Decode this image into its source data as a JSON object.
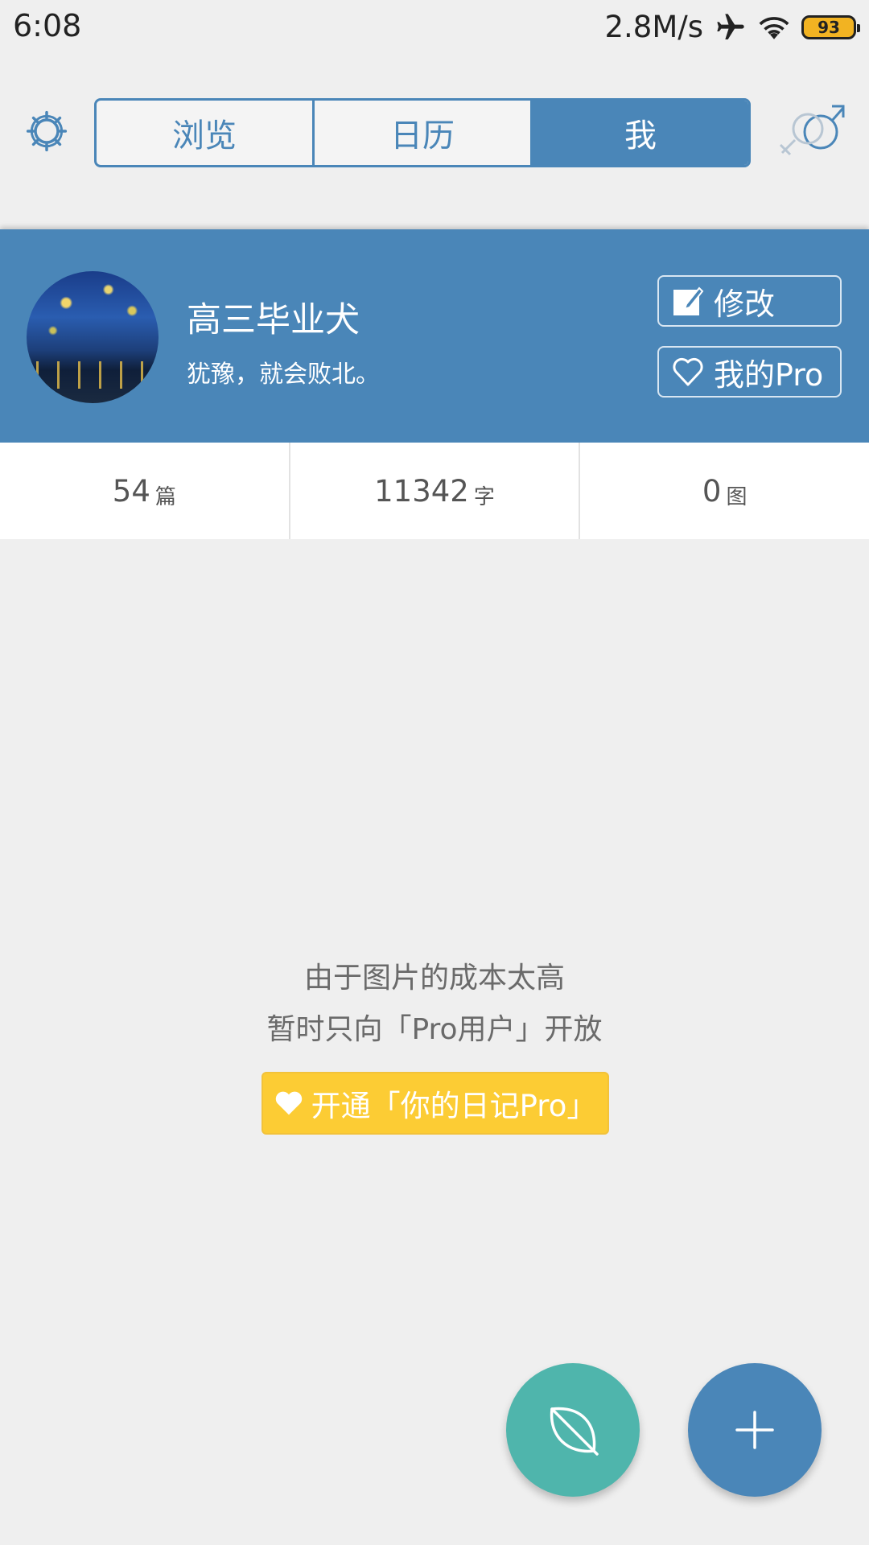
{
  "status_bar": {
    "time": "6:08",
    "net_speed": "2.8M/s",
    "battery": "93",
    "icons": [
      "airplane-icon",
      "wifi-icon",
      "battery-icon"
    ]
  },
  "header": {
    "tabs": [
      {
        "label": "浏览",
        "active": false
      },
      {
        "label": "日历",
        "active": false
      },
      {
        "label": "我",
        "active": true
      }
    ],
    "accent_color": "#4a86b8"
  },
  "profile": {
    "name": "高三毕业犬",
    "motto": "犹豫，就会败北。",
    "edit_label": "修改",
    "pro_label": "我的Pro"
  },
  "stats": [
    {
      "value": "54",
      "unit": "篇"
    },
    {
      "value": "11342",
      "unit": "字"
    },
    {
      "value": "0",
      "unit": "图"
    }
  ],
  "notice": {
    "line1": "由于图片的成本太高",
    "line2": "暂时只向「Pro用户」开放",
    "button_label": "开通「你的日记Pro」",
    "button_color": "#fccc34"
  },
  "fabs": {
    "leaf_color": "#4fb5ac",
    "add_color": "#4a86b8"
  }
}
